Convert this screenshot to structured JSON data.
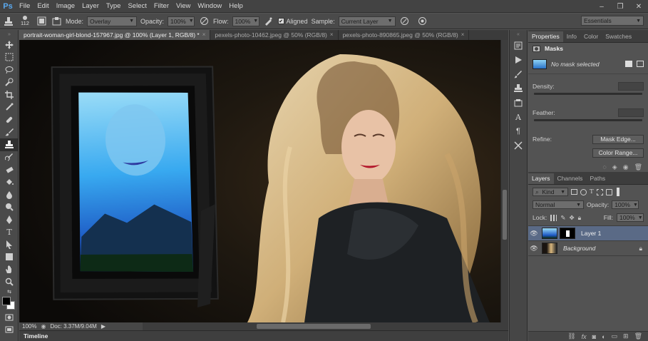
{
  "app": {
    "logo": "Ps"
  },
  "menu": [
    "File",
    "Edit",
    "Image",
    "Layer",
    "Type",
    "Select",
    "Filter",
    "View",
    "Window",
    "Help"
  ],
  "window_controls": {
    "minimize": "–",
    "restore": "❐",
    "close": "✕"
  },
  "options": {
    "brush_size": "112",
    "mode_label": "Mode:",
    "mode_value": "Overlay",
    "opacity_label": "Opacity:",
    "opacity_value": "100%",
    "flow_label": "Flow:",
    "flow_value": "100%",
    "aligned_label": "Aligned",
    "aligned_checked": true,
    "sample_label": "Sample:",
    "sample_value": "Current Layer",
    "workspace": "Essentials"
  },
  "tabs": [
    {
      "label": "portrait-woman-girl-blond-157967.jpg @ 100% (Layer 1, RGB/8) *",
      "active": true
    },
    {
      "label": "pexels-photo-10462.jpeg @ 50% (RGB/8)",
      "active": false
    },
    {
      "label": "pexels-photo-890865.jpeg @ 50% (RGB/8)",
      "active": false
    }
  ],
  "tab_close": "×",
  "status": {
    "zoom": "100%",
    "doc": "Doc: 3.37M/9.04M"
  },
  "timeline_label": "Timeline",
  "properties": {
    "tabs": [
      "Properties",
      "Info",
      "Color",
      "Swatches"
    ],
    "masks_title": "Masks",
    "mask_status": "No mask selected",
    "density_label": "Density:",
    "feather_label": "Feather:",
    "refine_label": "Refine:",
    "mask_edge_button": "Mask Edge...",
    "color_range_button": "Color Range..."
  },
  "layers": {
    "tabs": [
      "Layers",
      "Channels",
      "Paths"
    ],
    "kind_label": "Kind",
    "blend_mode": "Normal",
    "opacity_label": "Opacity:",
    "opacity_value": "100%",
    "lock_label": "Lock:",
    "fill_label": "Fill:",
    "fill_value": "100%",
    "items": [
      {
        "name": "Layer 1",
        "selected": true
      },
      {
        "name": "Background",
        "selected": false,
        "locked": true
      }
    ]
  },
  "colors": {
    "accent": "#5aa9ef",
    "selection": "#5a6a86",
    "panel": "#535353",
    "chrome": "#434343"
  }
}
